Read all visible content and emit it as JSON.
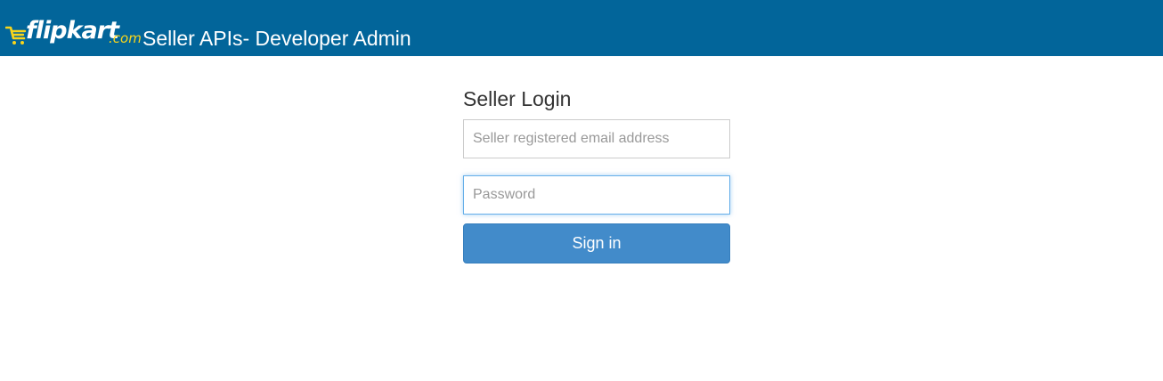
{
  "header": {
    "logo": {
      "wordmark": "flipkart",
      "suffix": ".com",
      "icon": "cart-icon",
      "suffix_color": "#f8d51b"
    },
    "title": "Seller APIs- Developer Admin",
    "background_color": "#02659a"
  },
  "login": {
    "title": "Seller Login",
    "email": {
      "value": "",
      "placeholder": "Seller registered email address"
    },
    "password": {
      "value": "",
      "placeholder": "Password",
      "focused": true
    },
    "submit_label": "Sign in",
    "submit_color": "#428bca"
  }
}
